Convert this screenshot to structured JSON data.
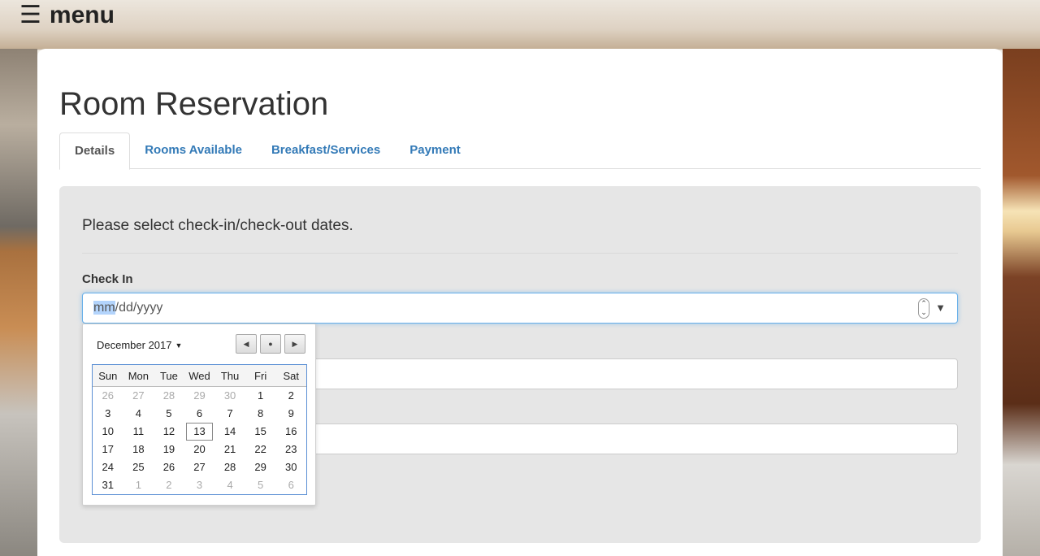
{
  "menu": {
    "icon": "hamburger-icon",
    "label": "menu"
  },
  "page": {
    "title": "Room Reservation"
  },
  "tabs": [
    {
      "label": "Details",
      "active": true
    },
    {
      "label": "Rooms Available",
      "active": false
    },
    {
      "label": "Breakfast/Services",
      "active": false
    },
    {
      "label": "Payment",
      "active": false
    }
  ],
  "details": {
    "instructions": "Please select check-in/check-out dates.",
    "check_in_label": "Check In",
    "check_in_value_highlight": "mm",
    "check_in_value_rest": "/dd/yyyy"
  },
  "calendar": {
    "month_label": "December 2017",
    "weekdays": [
      "Sun",
      "Mon",
      "Tue",
      "Wed",
      "Thu",
      "Fri",
      "Sat"
    ],
    "today": "13",
    "days": [
      {
        "d": "26",
        "m": true
      },
      {
        "d": "27",
        "m": true
      },
      {
        "d": "28",
        "m": true
      },
      {
        "d": "29",
        "m": true
      },
      {
        "d": "30",
        "m": true
      },
      {
        "d": "1",
        "m": false
      },
      {
        "d": "2",
        "m": false
      },
      {
        "d": "3",
        "m": false
      },
      {
        "d": "4",
        "m": false
      },
      {
        "d": "5",
        "m": false
      },
      {
        "d": "6",
        "m": false
      },
      {
        "d": "7",
        "m": false
      },
      {
        "d": "8",
        "m": false
      },
      {
        "d": "9",
        "m": false
      },
      {
        "d": "10",
        "m": false
      },
      {
        "d": "11",
        "m": false
      },
      {
        "d": "12",
        "m": false
      },
      {
        "d": "13",
        "m": false
      },
      {
        "d": "14",
        "m": false
      },
      {
        "d": "15",
        "m": false
      },
      {
        "d": "16",
        "m": false
      },
      {
        "d": "17",
        "m": false
      },
      {
        "d": "18",
        "m": false
      },
      {
        "d": "19",
        "m": false
      },
      {
        "d": "20",
        "m": false
      },
      {
        "d": "21",
        "m": false
      },
      {
        "d": "22",
        "m": false
      },
      {
        "d": "23",
        "m": false
      },
      {
        "d": "24",
        "m": false
      },
      {
        "d": "25",
        "m": false
      },
      {
        "d": "26",
        "m": false
      },
      {
        "d": "27",
        "m": false
      },
      {
        "d": "28",
        "m": false
      },
      {
        "d": "29",
        "m": false
      },
      {
        "d": "30",
        "m": false
      },
      {
        "d": "31",
        "m": false
      },
      {
        "d": "1",
        "m": true
      },
      {
        "d": "2",
        "m": true
      },
      {
        "d": "3",
        "m": true
      },
      {
        "d": "4",
        "m": true
      },
      {
        "d": "5",
        "m": true
      },
      {
        "d": "6",
        "m": true
      }
    ]
  },
  "colors": {
    "link": "#337ab7",
    "focus": "#66afe9",
    "well": "#e6e6e6"
  }
}
